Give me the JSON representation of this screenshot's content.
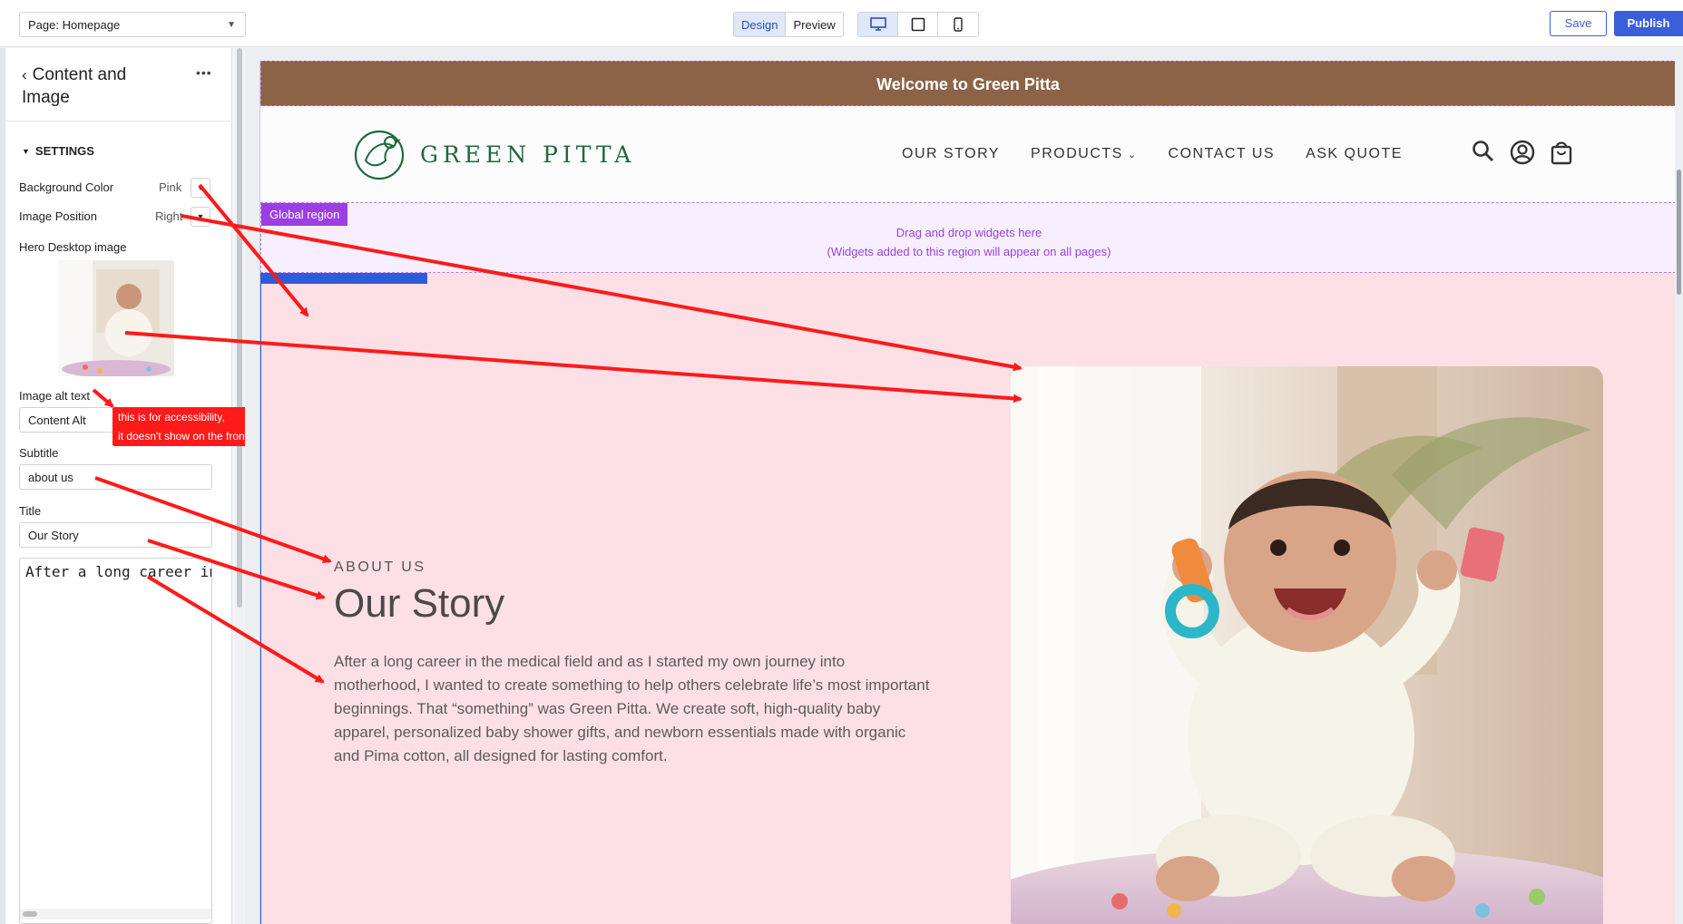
{
  "topbar": {
    "page_select": "Page: Homepage",
    "mode_design": "Design",
    "mode_preview": "Preview",
    "save": "Save",
    "publish": "Publish",
    "devices": [
      "desktop-icon",
      "tablet-icon",
      "mobile-icon"
    ]
  },
  "panel": {
    "title": "Content and Image",
    "settings": "SETTINGS",
    "bg_color_label": "Background Color",
    "bg_color_value": "Pink",
    "image_pos_label": "Image Position",
    "image_pos_value": "Right",
    "hero_image_label": "Hero Desktop image",
    "alt_label": "Image alt text",
    "alt_value": "Content Alt",
    "subtitle_label": "Subtitle",
    "subtitle_value": "about us",
    "title_label": "Title",
    "title_value": "Our Story",
    "body_value": "After a long career in"
  },
  "callout": {
    "line1": "this is for accessibility,",
    "line2": "it doesn't show on the front end"
  },
  "site": {
    "announcement": "Welcome to Green Pitta",
    "logo_text": "GREEN PITTA",
    "nav": [
      "OUR STORY",
      "PRODUCTS",
      "CONTACT US",
      "ASK QUOTE"
    ],
    "global_tag": "Global region",
    "global_msg1": "Drag and drop widgets here",
    "global_msg2": "(Widgets added to this region will appear on all pages)",
    "hero": {
      "subtitle": "ABOUT US",
      "title": "Our Story",
      "body": "After a long career in the medical field and as I started my own journey into motherhood, I wanted to create something to help others celebrate life’s most important beginnings. That “something” was Green Pitta. We create soft, high-quality baby apparel, personalized baby shower gifts, and newborn essentials made with organic and Pima cotton, all designed for lasting comfort."
    }
  },
  "colors": {
    "announcement_bg": "#8d6348",
    "hero_bg": "#fde0e6",
    "brand_green": "#1e6a3e",
    "accent_blue": "#3a5fd8",
    "global_purple": "#9b3fe0",
    "arrow_red": "#ff1a1a"
  }
}
